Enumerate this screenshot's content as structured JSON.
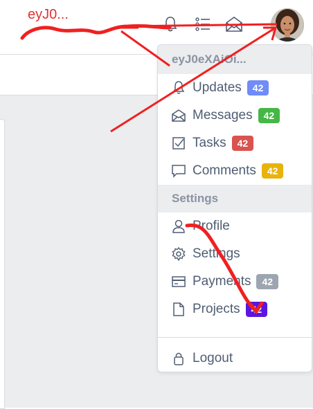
{
  "header": {
    "title": "eyJ0..."
  },
  "dropdown": {
    "account_header": "eyJ0eXAiOi...",
    "items": [
      {
        "label": "Updates",
        "badge": "42",
        "badge_color": "#6f8cf7",
        "icon": "bell-icon"
      },
      {
        "label": "Messages",
        "badge": "42",
        "badge_color": "#45b745",
        "icon": "envelope-open-icon"
      },
      {
        "label": "Tasks",
        "badge": "42",
        "badge_color": "#d9534f",
        "icon": "task-icon"
      },
      {
        "label": "Comments",
        "badge": "42",
        "badge_color": "#e8b30c",
        "icon": "comment-icon"
      }
    ],
    "settings_header": "Settings",
    "settings_items": [
      {
        "label": "Profile",
        "icon": "user-icon"
      },
      {
        "label": "Settings",
        "icon": "gear-icon"
      },
      {
        "label": "Payments",
        "badge": "42",
        "badge_color": "#9da5b1",
        "icon": "credit-card-icon"
      },
      {
        "label": "Projects",
        "badge": "42",
        "badge_color": "#5a16e0",
        "icon": "file-icon"
      }
    ],
    "logout_label": "Logout"
  }
}
